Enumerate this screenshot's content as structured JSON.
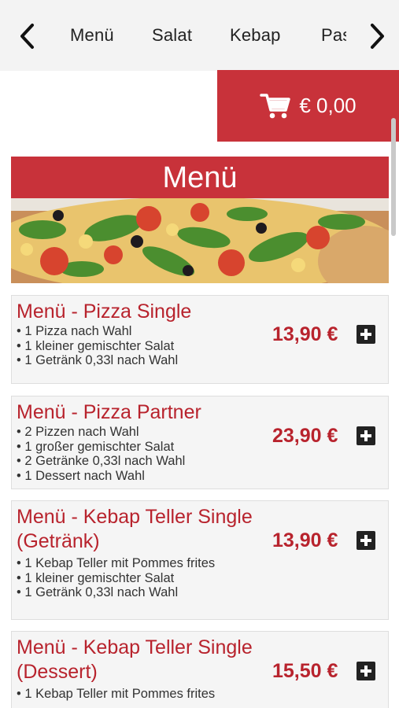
{
  "nav": {
    "back_icon": "chevron-left-icon",
    "forward_icon": "chevron-right-icon",
    "tabs": [
      {
        "label": "Menü"
      },
      {
        "label": "Salat"
      },
      {
        "label": "Kebap"
      },
      {
        "label": "Pasta"
      }
    ]
  },
  "cart": {
    "icon": "shopping-cart-icon",
    "total": "€ 0,00"
  },
  "section": {
    "title": "Menü",
    "banner_image": "pizza-photo"
  },
  "items": [
    {
      "title": "Menü - Pizza Single",
      "lines": [
        "1 Pizza nach Wahl",
        "1 kleiner gemischter Salat",
        "1 Getränk 0,33l nach Wahl"
      ],
      "price": "13,90 €"
    },
    {
      "title": "Menü - Pizza Partner",
      "lines": [
        "2 Pizzen nach Wahl",
        "1 großer gemischter Salat",
        "2 Getränke 0,33l nach Wahl",
        "1 Dessert nach Wahl"
      ],
      "price": "23,90 €"
    },
    {
      "title": "Menü - Kebap Teller Single (Getränk)",
      "lines": [
        "1 Kebap Teller mit Pommes frites",
        "1 kleiner gemischter Salat",
        "1 Getränk 0,33l nach Wahl"
      ],
      "price": "13,90 €"
    },
    {
      "title": "Menü - Kebap Teller Single (Dessert)",
      "lines": [
        "1 Kebap Teller mit Pommes frites"
      ],
      "price": "15,50 €"
    }
  ],
  "colors": {
    "accent": "#c8323a",
    "title_text": "#b8232d",
    "nav_bg": "#f3f3f3"
  }
}
